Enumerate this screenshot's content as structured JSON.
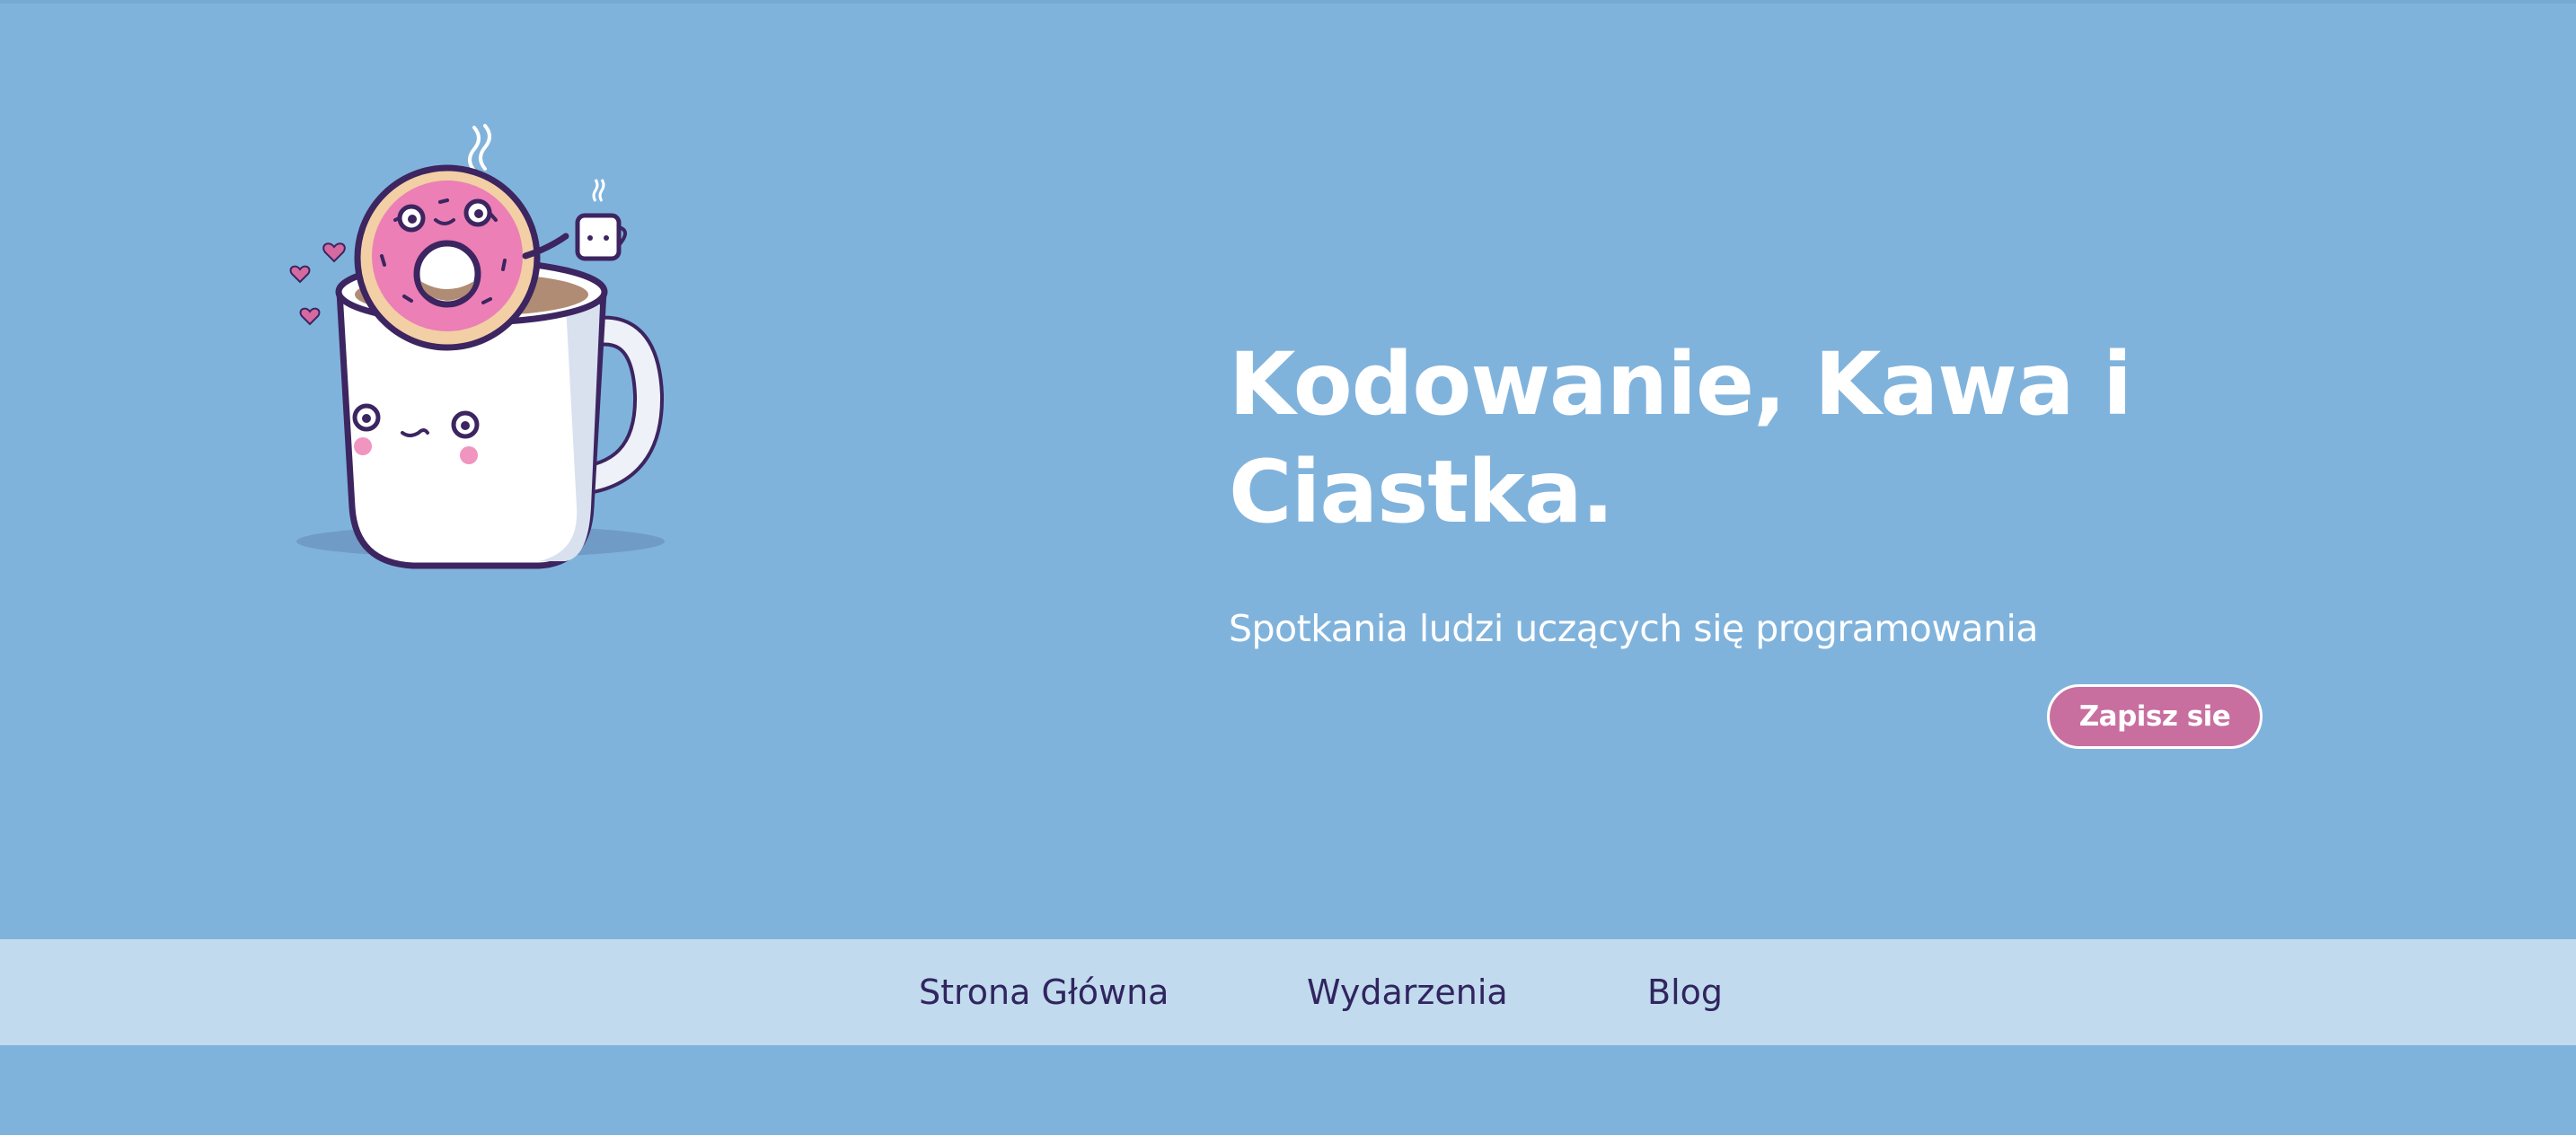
{
  "hero": {
    "title": "Kodowanie, Kawa i Ciastka.",
    "subtitle": "Spotkania ludzi uczących się programowania",
    "cta_label": "Zapisz sie",
    "illustration_icon": "donut-in-coffee-mug-icon"
  },
  "nav": {
    "items": [
      {
        "label": "Strona Główna"
      },
      {
        "label": "Wydarzenia"
      },
      {
        "label": "Blog"
      }
    ]
  },
  "colors": {
    "background": "#80b3dc",
    "nav_background": "#c1daee",
    "nav_text": "#30255e",
    "cta_background": "#c86fa0",
    "heading_text": "#ffffff"
  }
}
